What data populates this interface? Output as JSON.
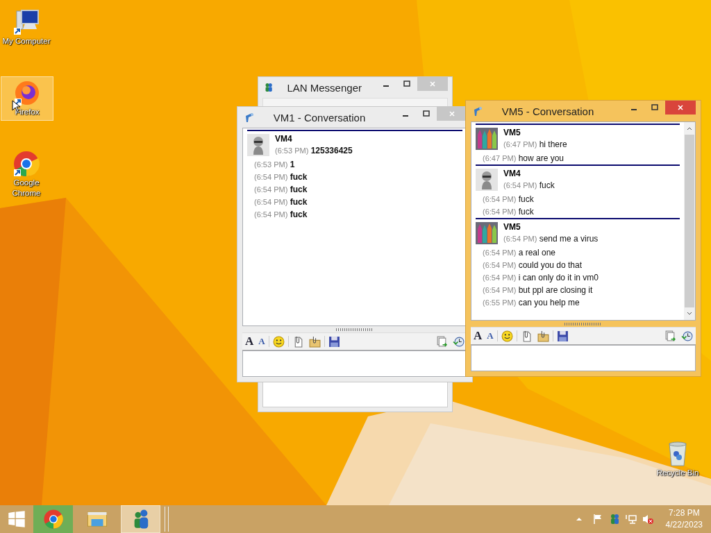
{
  "desktop_icons": [
    {
      "kind": "computer",
      "label": "My Computer",
      "selected": false
    },
    {
      "kind": "firefox",
      "label": "Firefox",
      "selected": true
    },
    {
      "kind": "chrome",
      "label": "Google Chrome",
      "selected": false
    },
    {
      "kind": "recycle",
      "label": "Recycle Bin",
      "selected": false
    }
  ],
  "lan_messenger": {
    "title": "LAN Messenger"
  },
  "conversations": [
    {
      "title": "VM1 - Conversation",
      "active": false,
      "bold_messages": true,
      "groups": [
        {
          "sender": "VM4",
          "kind": "robot",
          "messages": [
            {
              "time": "(6:53 PM)",
              "text": "125336425"
            },
            {
              "time": "(6:53 PM)",
              "text": "1"
            },
            {
              "time": "(6:54 PM)",
              "text": "fuck"
            },
            {
              "time": "(6:54 PM)",
              "text": "fuck"
            },
            {
              "time": "(6:54 PM)",
              "text": "fuck"
            },
            {
              "time": "(6:54 PM)",
              "text": "fuck"
            }
          ]
        }
      ],
      "toolbar": [
        {
          "kind": "font",
          "glyph": "A"
        },
        {
          "kind": "font_color",
          "glyph": "A"
        },
        {
          "kind": "smiley"
        },
        {
          "kind": "file"
        },
        {
          "kind": "folder"
        },
        {
          "kind": "save"
        },
        {
          "kind": "transfer"
        },
        {
          "kind": "history"
        }
      ]
    },
    {
      "title": "VM5 - Conversation",
      "active": true,
      "bold_messages": false,
      "groups": [
        {
          "sender": "VM5",
          "kind": "crayons",
          "messages": [
            {
              "time": "(6:47 PM)",
              "text": "hi there"
            },
            {
              "time": "(6:47 PM)",
              "text": "how are you"
            }
          ]
        },
        {
          "sender": "VM4",
          "kind": "robot",
          "messages": [
            {
              "time": "(6:54 PM)",
              "text": "fuck"
            },
            {
              "time": "(6:54 PM)",
              "text": "fuck"
            },
            {
              "time": "(6:54 PM)",
              "text": "fuck"
            }
          ]
        },
        {
          "sender": "VM5",
          "kind": "crayons",
          "messages": [
            {
              "time": "(6:54 PM)",
              "text": "send me a virus"
            },
            {
              "time": "(6:54 PM)",
              "text": "a real one"
            },
            {
              "time": "(6:54 PM)",
              "text": "could you do that"
            },
            {
              "time": "(6:54 PM)",
              "text": "i can only do it in vm0"
            },
            {
              "time": "(6:54 PM)",
              "text": "but ppl are closing it"
            },
            {
              "time": "(6:55 PM)",
              "text": "can you help me"
            }
          ]
        }
      ],
      "toolbar": [
        {
          "kind": "font",
          "glyph": "A"
        },
        {
          "kind": "font_color",
          "glyph": "A"
        },
        {
          "kind": "smiley"
        },
        {
          "kind": "file"
        },
        {
          "kind": "folder"
        },
        {
          "kind": "save"
        },
        {
          "kind": "transfer"
        },
        {
          "kind": "history"
        }
      ]
    }
  ],
  "taskbar": {
    "items": [
      {
        "kind": "chrome",
        "flashing": true,
        "selected": false
      },
      {
        "kind": "explorer",
        "flashing": false,
        "selected": false
      },
      {
        "kind": "messenger",
        "flashing": false,
        "selected": true
      }
    ],
    "clock": {
      "time": "7:28 PM",
      "date": "4/22/2023"
    }
  }
}
